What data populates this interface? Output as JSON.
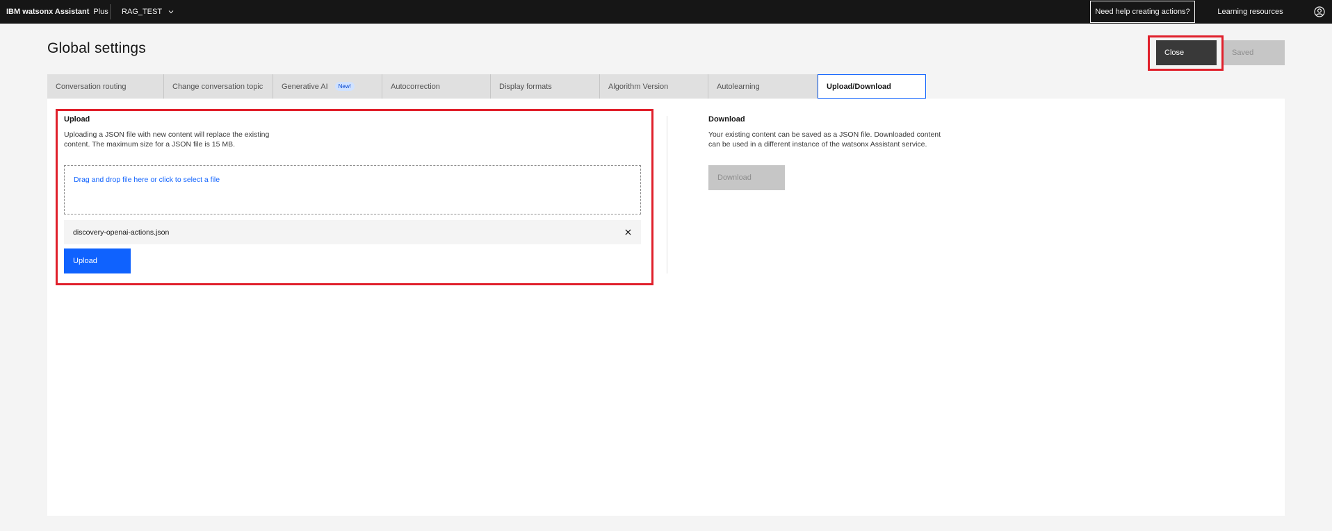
{
  "header": {
    "brand_bold": "IBM watsonx Assistant",
    "brand_plan": "Plus",
    "assistant_name": "RAG_TEST",
    "help_button": "Need help creating actions?",
    "learning_resources": "Learning resources",
    "icons": {
      "assistant_dropdown": "chevron-down-icon",
      "user": "user-avatar-icon"
    }
  },
  "page": {
    "title": "Global settings",
    "close_label": "Close",
    "saved_label": "Saved"
  },
  "tabs": [
    {
      "label": "Conversation routing"
    },
    {
      "label": "Change conversation topic"
    },
    {
      "label": "Generative AI",
      "badge": "New!"
    },
    {
      "label": "Autocorrection"
    },
    {
      "label": "Display formats"
    },
    {
      "label": "Algorithm Version"
    },
    {
      "label": "Autolearning"
    },
    {
      "label": "Upload/Download",
      "active": true
    }
  ],
  "upload": {
    "title": "Upload",
    "description": "Uploading a JSON file with new content will replace the existing content. The maximum size for a JSON file is 15 MB.",
    "dropzone_text": "Drag and drop file here or click to select a file",
    "file_name": "discovery-openai-actions.json",
    "button_label": "Upload"
  },
  "download": {
    "title": "Download",
    "description": "Your existing content can be saved as a JSON file. Downloaded content can be used in a different instance of the watsonx Assistant service.",
    "button_label": "Download"
  },
  "colors": {
    "header_bg": "#161616",
    "primary_blue": "#0f62fe",
    "highlight_red": "#e0202b",
    "close_button": "#393939",
    "disabled_button": "#c6c6c6"
  }
}
